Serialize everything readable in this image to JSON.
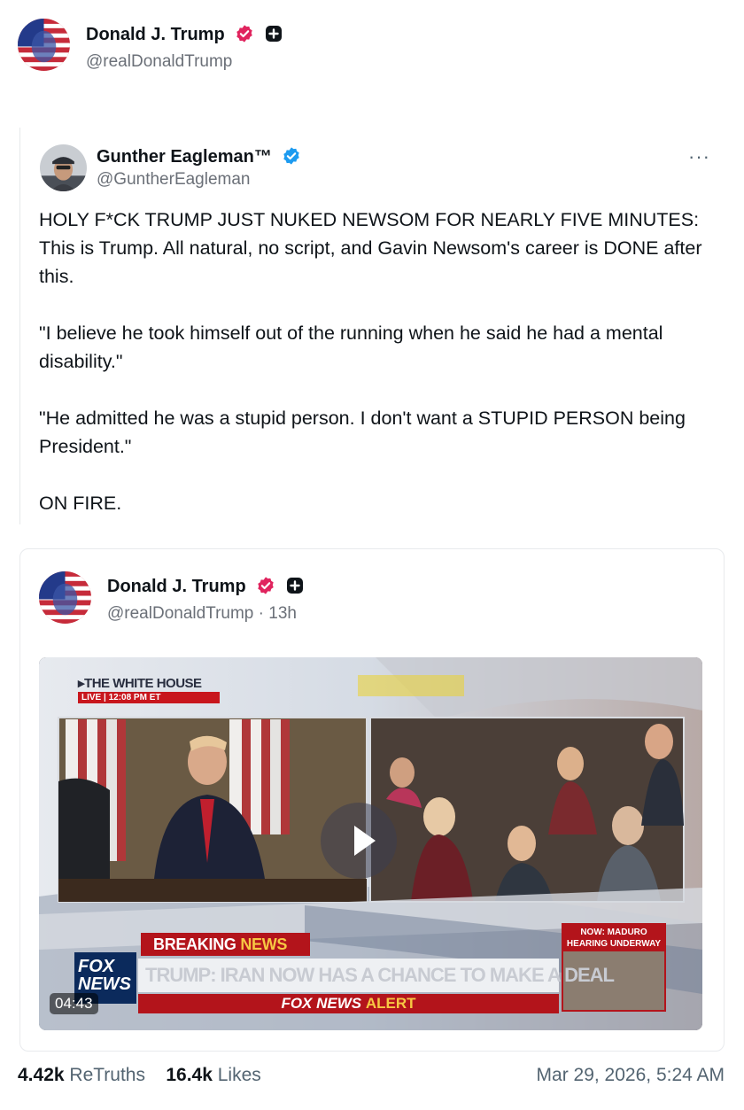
{
  "author": {
    "name": "Donald J. Trump",
    "handle": "@realDonaldTrump"
  },
  "quoted": {
    "name": "Gunther Eagleman™",
    "handle": "@GuntherEagleman",
    "more": "···",
    "paragraphs": [
      "HOLY F*CK TRUMP JUST NUKED NEWSOM FOR NEARLY FIVE MINUTES: This is Trump. All natural, no script, and Gavin Newsom's career is DONE after this.",
      "\"I believe he took himself out of the running when he said he had a mental disability.\"",
      "\"He admitted he was a stupid person. I don't want a STUPID PERSON being President.\"",
      "ON FIRE."
    ]
  },
  "card": {
    "name": "Donald J. Trump",
    "handle_time": "@realDonaldTrump · 13h",
    "video": {
      "source_label": "▸THE WHITE HOUSE",
      "live_label": "LIVE  |  12:08 PM ET",
      "breaking_part1": "BREAKING ",
      "breaking_part2": "NEWS",
      "headline": "TRUMP: IRAN NOW HAS A CHANCE TO MAKE A DEAL",
      "alert_part1": "FOX NEWS ",
      "alert_part2": "ALERT",
      "fox_logo": "FOX NEWS",
      "side_title": "NOW: MADURO HEARING UNDERWAY",
      "duration": "04:43"
    }
  },
  "stats": {
    "retruths_count": "4.42k",
    "retruths_label": "ReTruths",
    "likes_count": "16.4k",
    "likes_label": "Likes",
    "timestamp": "Mar 29, 2026, 5:24 AM"
  },
  "colors": {
    "verified_pink": "#e0245e",
    "verified_blue": "#1d9bf0",
    "fox_red": "#b3141b",
    "text_muted": "#536471"
  }
}
